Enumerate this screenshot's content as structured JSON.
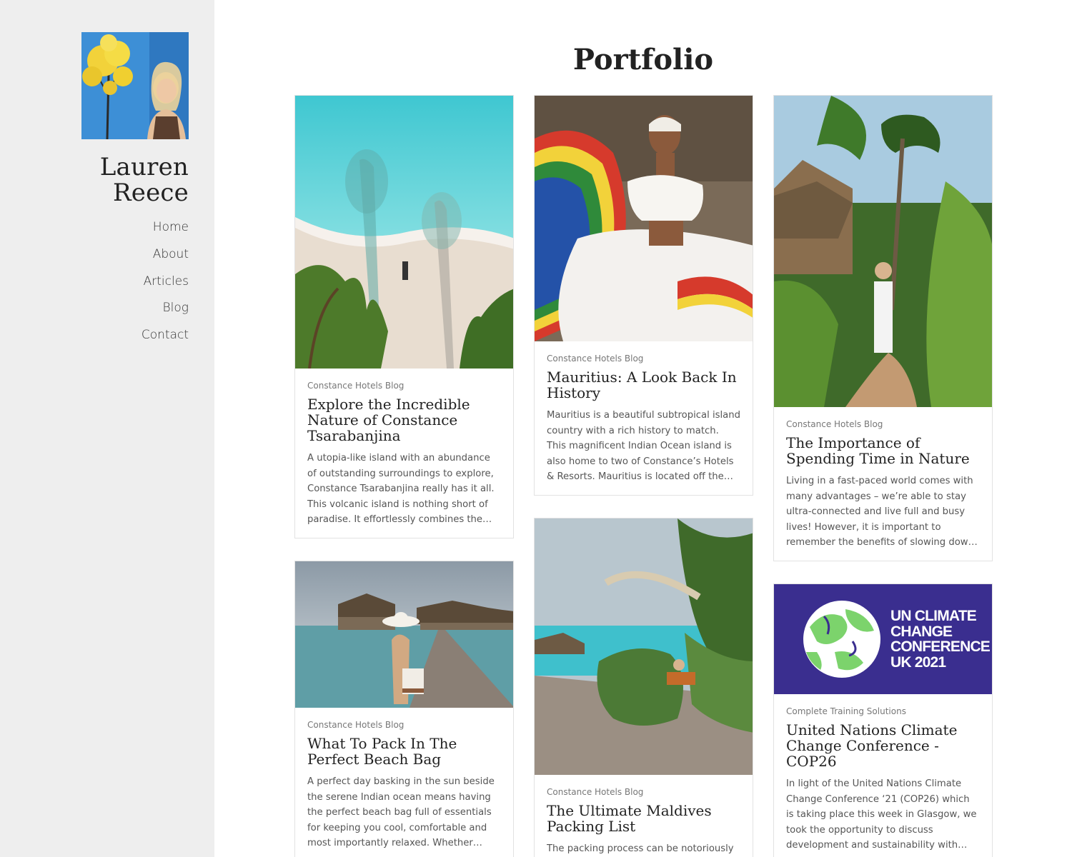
{
  "sidebar": {
    "name": "Lauren Reece",
    "nav": [
      "Home",
      "About",
      "Articles",
      "Blog",
      "Contact"
    ]
  },
  "main": {
    "title": "Portfolio",
    "cards": [
      {
        "category": "Constance Hotels Blog",
        "title": "Explore the Incredible Nature of Constance Tsarabanjina",
        "excerpt": "A utopia-like island with an abundance of outstanding surroundings to explore, Constance Tsarabanjina really has it all. This volcanic island is nothing short of paradise. It effortlessly combines the barefoot…",
        "image": "aerial-beach-palm-shadows"
      },
      {
        "category": "Constance Hotels Blog",
        "title": "Mauritius: A Look Back In History",
        "excerpt": "Mauritius is a beautiful subtropical island country with a rich history to match. This magnificent Indian Ocean island is also home to two of Constance’s Hotels & Resorts. Mauritius is located off the south-…",
        "image": "sega-dancer"
      },
      {
        "category": "Constance Hotels Blog",
        "title": "The Importance of Spending Time in Nature",
        "excerpt": "Living in a fast-paced world comes with many advantages – we’re able to stay ultra-connected and live full and busy lives! However, it is important to remember the benefits of slowing down and going back t…",
        "image": "jungle-path"
      },
      {
        "category": "Constance Hotels Blog",
        "title": "What To Pack In The Perfect Beach Bag",
        "excerpt": "A perfect day basking in the sun beside the serene Indian ocean means having the perfect beach bag full of essentials for keeping you cool, comfortable and most importantly relaxed. Whether you’re…",
        "image": "overwater-jetty"
      },
      {
        "category": "Constance Hotels Blog",
        "title": "The Ultimate Maldives Packing List",
        "excerpt": "The packing process can be notoriously",
        "image": "maldives-swing"
      },
      {
        "category": "Complete Training Solutions",
        "title": "United Nations Climate Change Conference - COP26",
        "excerpt": "In light of the United Nations Climate Change Conference ‘21 (COP26) which is taking place this week in Glasgow, we took the opportunity to discuss development and sustainability with Danielle Kershaw, Head…",
        "image": "cop26-logo",
        "logo_text": [
          "UN CLIMATE",
          "CHANGE",
          "CONFERENCE",
          "UK 2021"
        ],
        "logo_bg": "#3a2e8f"
      }
    ]
  },
  "colors": {
    "sidebar_bg": "#eeeeee",
    "card_border": "#e2e2e2",
    "cop26_blue": "#3a2e8f"
  }
}
